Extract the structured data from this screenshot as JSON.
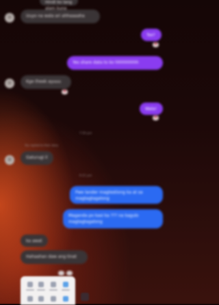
{
  "messages": [
    {
      "id": "m1",
      "text": "Hindi ko lang alam kung ano",
      "side": "in"
    },
    {
      "id": "m2",
      "text": "Uuyo na wala ari ahhaaaaha",
      "side": "in"
    },
    {
      "id": "m3",
      "text": "Tse?",
      "side": "out"
    },
    {
      "id": "m4",
      "text": "Yes share data to ko hhhhhhhhh",
      "side": "out"
    },
    {
      "id": "m5",
      "text": "Kge theek ayuuu",
      "side": "in"
    },
    {
      "id": "m6",
      "text": "Wala!",
      "side": "out"
    },
    {
      "id": "m7",
      "text": "Gaturugi il",
      "side": "in"
    },
    {
      "id": "m8",
      "text": "Pwe lander magtestiong ka at sa magtagtagalong",
      "side": "out"
    },
    {
      "id": "m9",
      "text": "Maganda po kasi ka ??? na kagulo magtagtagalong",
      "side": "out"
    },
    {
      "id": "m10",
      "text": "ka awat",
      "side": "in"
    },
    {
      "id": "m11",
      "text": "Hahaahan daw ang tinat",
      "side": "in"
    }
  ],
  "meta": {
    "timestamp_1": "7:50 pm",
    "reply_label": "You replied to their story",
    "timestamp_2": "9:21 pm"
  },
  "reactions": {
    "heart": "♥"
  }
}
